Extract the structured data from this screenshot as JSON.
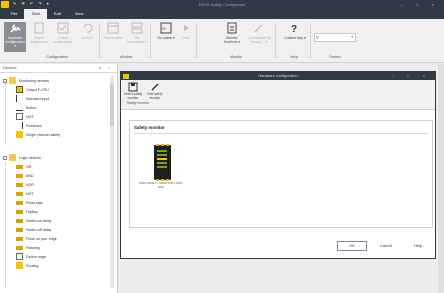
{
  "app": {
    "title": "RSO5 Safety Configurator"
  },
  "menu_tabs": [
    {
      "label": "File"
    },
    {
      "label": "Start"
    },
    {
      "label": "Edit"
    },
    {
      "label": "View"
    }
  ],
  "ribbon": {
    "buttons": [
      {
        "label": "Hardware configuration ▾",
        "icon": "wrench-icon",
        "enabled": true,
        "selected": true
      },
      {
        "label": "Output assignment",
        "icon": "document-icon",
        "enabled": false
      },
      {
        "label": "Check configuration",
        "icon": "check-icon",
        "enabled": false
      },
      {
        "label": "Undo ▾",
        "icon": "undo-icon",
        "enabled": false
      },
      {
        "label": "New monitor",
        "icon": "window-icon",
        "enabled": false
      },
      {
        "label": "Tile horizontally ▾",
        "icon": "tile-icon",
        "enabled": false
      },
      {
        "label": "Go online ▾",
        "icon": "link-icon",
        "enabled": true
      },
      {
        "label": "Start",
        "icon": "play-icon",
        "enabled": false
      },
      {
        "label": "Monitor functions ▾",
        "icon": "monitor-icon",
        "enabled": true
      },
      {
        "label": "Commissioning wizard… ▾",
        "icon": "magic-wand-icon",
        "enabled": false
      },
      {
        "label": "Context help ▾",
        "icon": "help-icon",
        "enabled": true
      }
    ],
    "groups": [
      {
        "label": "Configuration"
      },
      {
        "label": "Window"
      },
      {
        "label": "Monitor"
      },
      {
        "label": "Help"
      },
      {
        "label": "Search"
      }
    ],
    "search": {
      "value": "",
      "icon": "search-icon"
    }
  },
  "devices_panel": {
    "title": "Devices",
    "header_controls": "# ×",
    "groups": [
      {
        "label": "Monitoring devices",
        "items": [
          {
            "label": "Output F-CPU"
          },
          {
            "label": "Standard input"
          },
          {
            "label": "Button"
          },
          {
            "label": "NOT"
          },
          {
            "label": "Feedback"
          },
          {
            "label": "Single channel safety"
          }
        ]
      },
      {
        "label": "Logic devices",
        "items": [
          {
            "label": "OR"
          },
          {
            "label": "AND"
          },
          {
            "label": "XOR"
          },
          {
            "label": "NOT"
          },
          {
            "label": "Pulse sign"
          },
          {
            "label": "Flipflop"
          },
          {
            "label": "Switch-on delay"
          },
          {
            "label": "Switch-off delay"
          },
          {
            "label": "Pulse on pos. edge"
          },
          {
            "label": "Flashing"
          },
          {
            "label": "Device edge"
          },
          {
            "label": "Routing"
          }
        ]
      }
    ]
  },
  "dialog": {
    "title": "Hardware configuration",
    "window_controls": "– □ ×",
    "ribbon_buttons": [
      {
        "label": "Select safety monitor",
        "icon": "save-icon"
      },
      {
        "label": "Edit safety monitor",
        "icon": "pencil-icon"
      }
    ],
    "ribbon_group": "Safety monitor",
    "section_title": "Safety monitor",
    "module_label": "ASM  SAFETY MONITOR (ASO-SM)",
    "buttons": {
      "ok": "OK",
      "cancel": "Cancel",
      "help": "Help"
    }
  },
  "colors": {
    "titlebar": "#2f3a45",
    "accent": "#f5c300",
    "folder": "#f2c94c",
    "module": "#1f1f1f"
  }
}
